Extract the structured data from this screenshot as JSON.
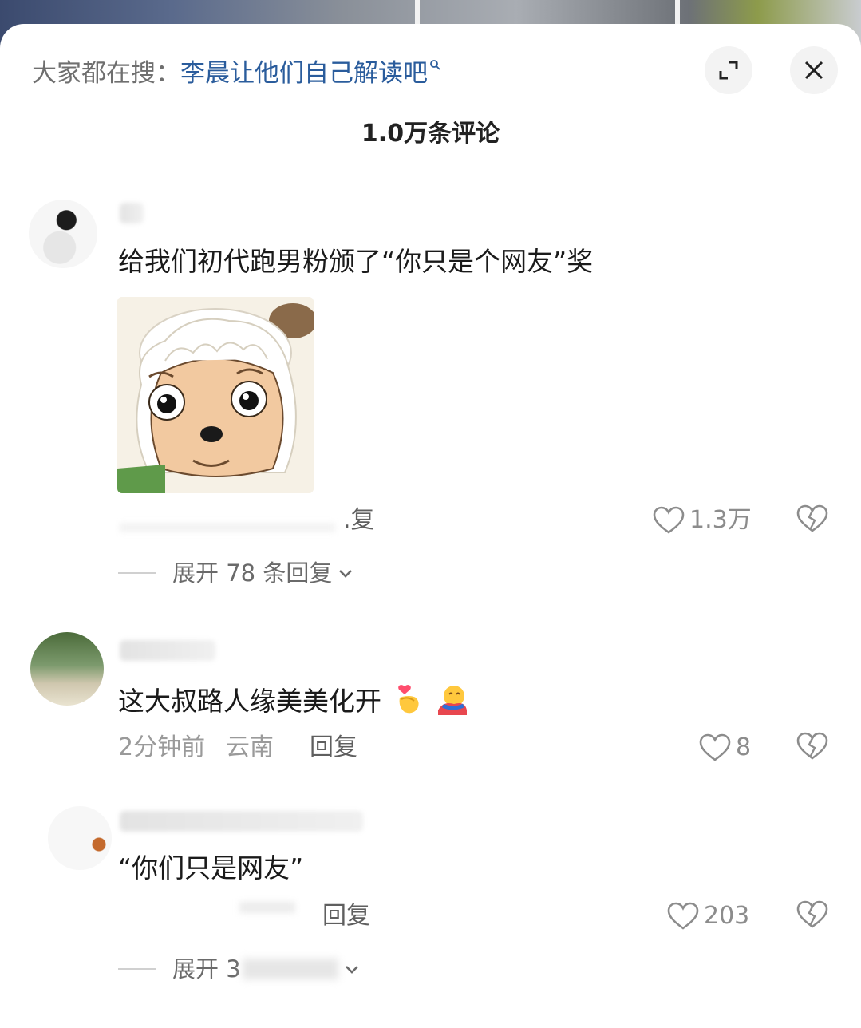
{
  "header": {
    "search_prefix": "大家都在搜：",
    "search_term": "李晨让他们自己解读吧",
    "expand_icon": "expand-icon",
    "close_icon": "close-icon",
    "comment_count": "1.0万条评论"
  },
  "comments": [
    {
      "text": "给我们初代跑男粉颁了“你只是个网友”奖",
      "sticker": "cartoon-sheep-sticker",
      "reply_label": ".复",
      "likes": "1.3万",
      "expand_replies": "展开 78 条回复"
    },
    {
      "text": "这大叔路人缘美美化开",
      "emojis": [
        "finger-heart-emoji",
        "hugging-face-emoji"
      ],
      "time": "2分钟前",
      "location": "云南",
      "reply_label": "回复",
      "likes": "8"
    },
    {
      "text": "“你们只是网友”",
      "reply_label": "回复",
      "likes": "203",
      "expand_replies": "展开 3"
    }
  ],
  "colors": {
    "search_term": "#2a5c9c",
    "text_primary": "#1a1a1a",
    "text_meta": "#9a9a9a"
  }
}
